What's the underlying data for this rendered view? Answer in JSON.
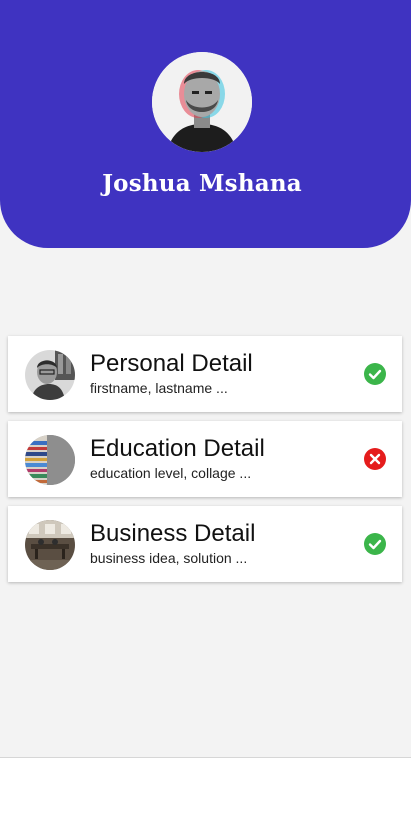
{
  "profile": {
    "name": "Joshua Mshana",
    "avatar_icon": "person-photo"
  },
  "colors": {
    "header": "#3f33c1",
    "complete": "#3bb54a",
    "incomplete": "#e51c1c"
  },
  "sections": [
    {
      "title": "Personal Detail",
      "subtitle": "firstname, lastname ...",
      "thumb_icon": "person-photo",
      "status": "complete",
      "status_icon": "check-circle-icon"
    },
    {
      "title": "Education Detail",
      "subtitle": "education level, collage ...",
      "thumb_icon": "books-photo",
      "status": "incomplete",
      "status_icon": "x-circle-icon"
    },
    {
      "title": "Business Detail",
      "subtitle": "business idea, solution ...",
      "thumb_icon": "office-photo",
      "status": "complete",
      "status_icon": "check-circle-icon"
    }
  ]
}
